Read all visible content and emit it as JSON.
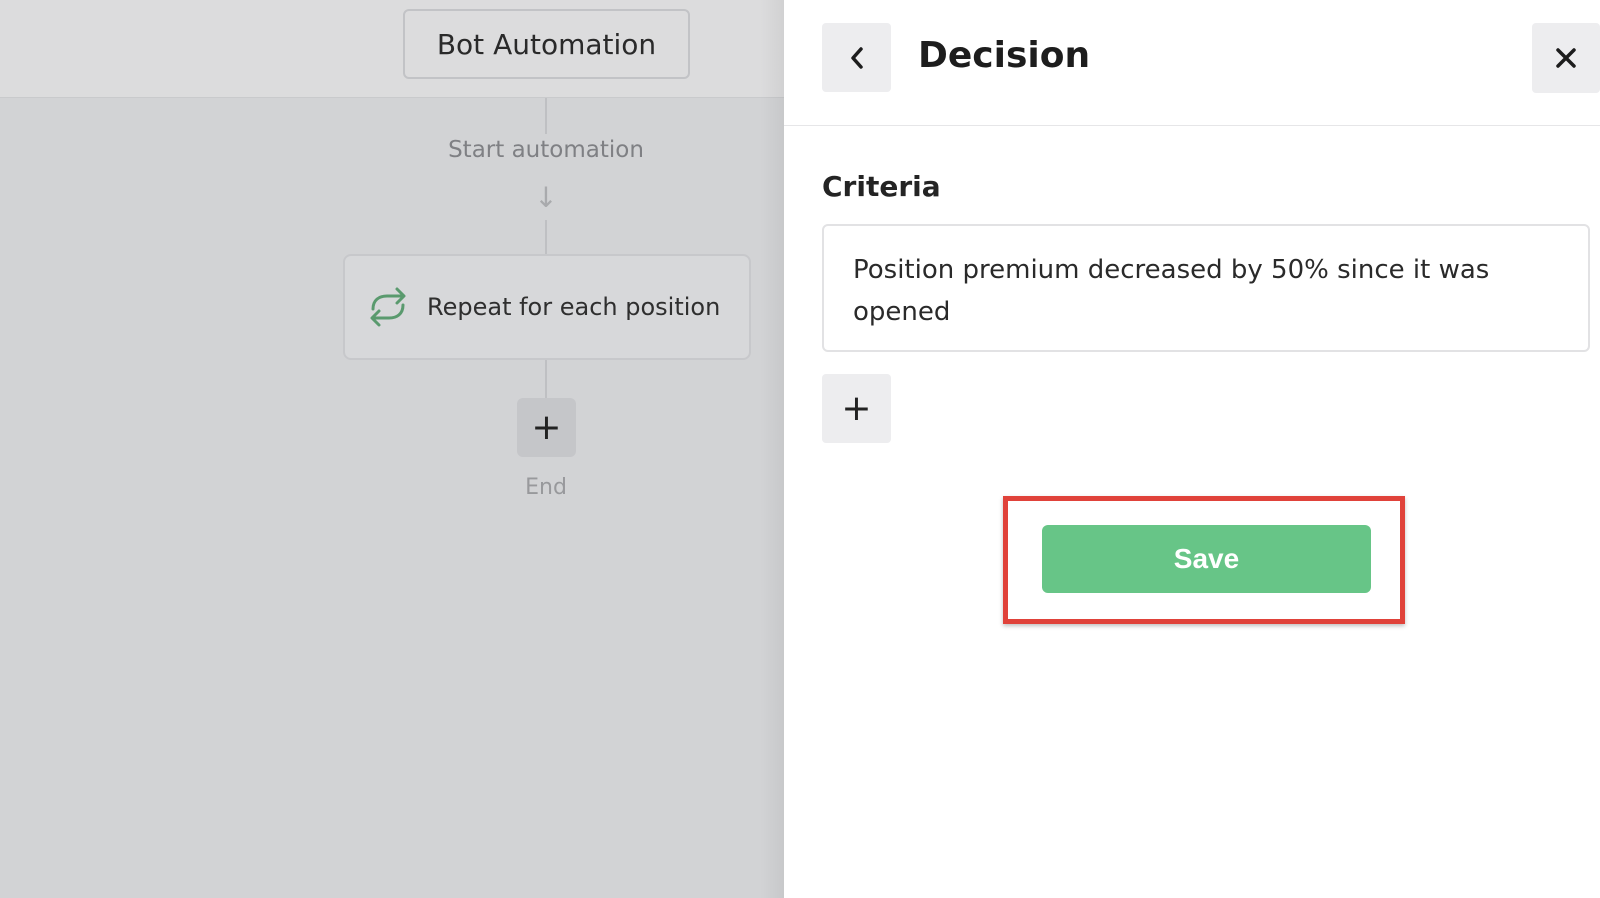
{
  "canvas": {
    "title_button": "Bot Automation",
    "start_label": "Start automation",
    "step": {
      "label": "Repeat for each position",
      "icon": "repeat-icon"
    },
    "add_step_symbol": "+",
    "end_label": "End"
  },
  "panel": {
    "title": "Decision",
    "back_icon": "chevron-left-icon",
    "close_icon": "close-icon",
    "criteria_label": "Criteria",
    "criteria_value": "Position premium decreased by 50% since it was opened",
    "add_criteria_symbol": "+",
    "save_label": "Save"
  },
  "colors": {
    "save_button": "#67c587",
    "highlight_border": "#e0423a",
    "repeat_icon": "#5a9a6e"
  }
}
